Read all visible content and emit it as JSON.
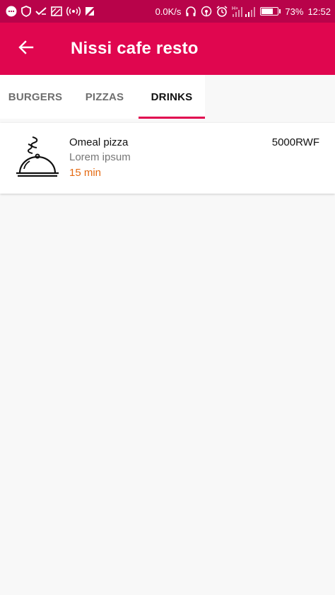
{
  "status_bar": {
    "network_speed": "0.0K/s",
    "battery_percent": "73%",
    "battery_level": 0.73,
    "time": "12:52",
    "signal_label": "H+",
    "icons": [
      "chat-icon",
      "shield-icon",
      "check-icon",
      "cast-icon",
      "hotspot-icon",
      "play-icon",
      "headphones-icon",
      "wifi-icon",
      "alarm-icon",
      "signal-icon",
      "battery-icon"
    ]
  },
  "app_bar": {
    "title": "Nissi cafe resto",
    "back_icon": "arrow-back-icon"
  },
  "tabs": [
    {
      "label": "BURGERS",
      "active": false
    },
    {
      "label": "PIZZAS",
      "active": false
    },
    {
      "label": "DRINKS",
      "active": true
    }
  ],
  "menu_items": [
    {
      "name": "Omeal pizza",
      "description": "Lorem ipsum",
      "time": "15 min",
      "price": "5000RWF",
      "icon": "food-cloche-icon"
    }
  ],
  "colors": {
    "status_bar": "#b8034a",
    "app_bar": "#e0064f",
    "accent": "#e0064f",
    "time_text": "#e46a12"
  }
}
